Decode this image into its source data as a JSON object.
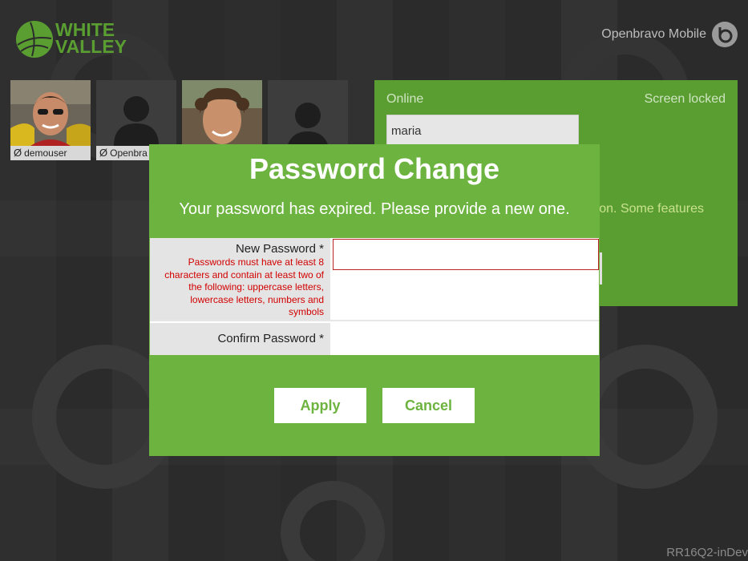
{
  "brand": {
    "text_line1": "WHITE",
    "text_line2": "VALLEY",
    "color": "#5a9e32"
  },
  "header": {
    "product_name": "Openbravo Mobile",
    "product_icon": "openbravo-logo-icon"
  },
  "users": [
    {
      "name": "demouser",
      "status_icon": "Ø",
      "photo": "person-photo-1"
    },
    {
      "name": "Openbra",
      "status_icon": "Ø",
      "photo": "default-avatar"
    },
    {
      "name": "",
      "status_icon": "",
      "photo": "person-photo-2"
    },
    {
      "name": "",
      "status_icon": "",
      "photo": "default-avatar"
    }
  ],
  "login_panel": {
    "status_online": "Online",
    "status_locked": "Screen locked",
    "username_value": "maria",
    "message_fragment": "on. Some features",
    "color": "#5a9e32"
  },
  "modal": {
    "title": "Password Change",
    "subtitle": "Your password has expired. Please provide a new one.",
    "new_password_label": "New Password *",
    "new_password_hint": "Passwords must have at least 8 characters and contain at least two of the following: uppercase letters, lowercase letters, numbers and symbols",
    "confirm_password_label": "Confirm Password *",
    "new_password_value": "",
    "confirm_password_value": "",
    "apply_label": "Apply",
    "cancel_label": "Cancel",
    "color": "#6db33f",
    "error_color": "#d20000"
  },
  "footer": {
    "version": "RR16Q2-inDev"
  }
}
